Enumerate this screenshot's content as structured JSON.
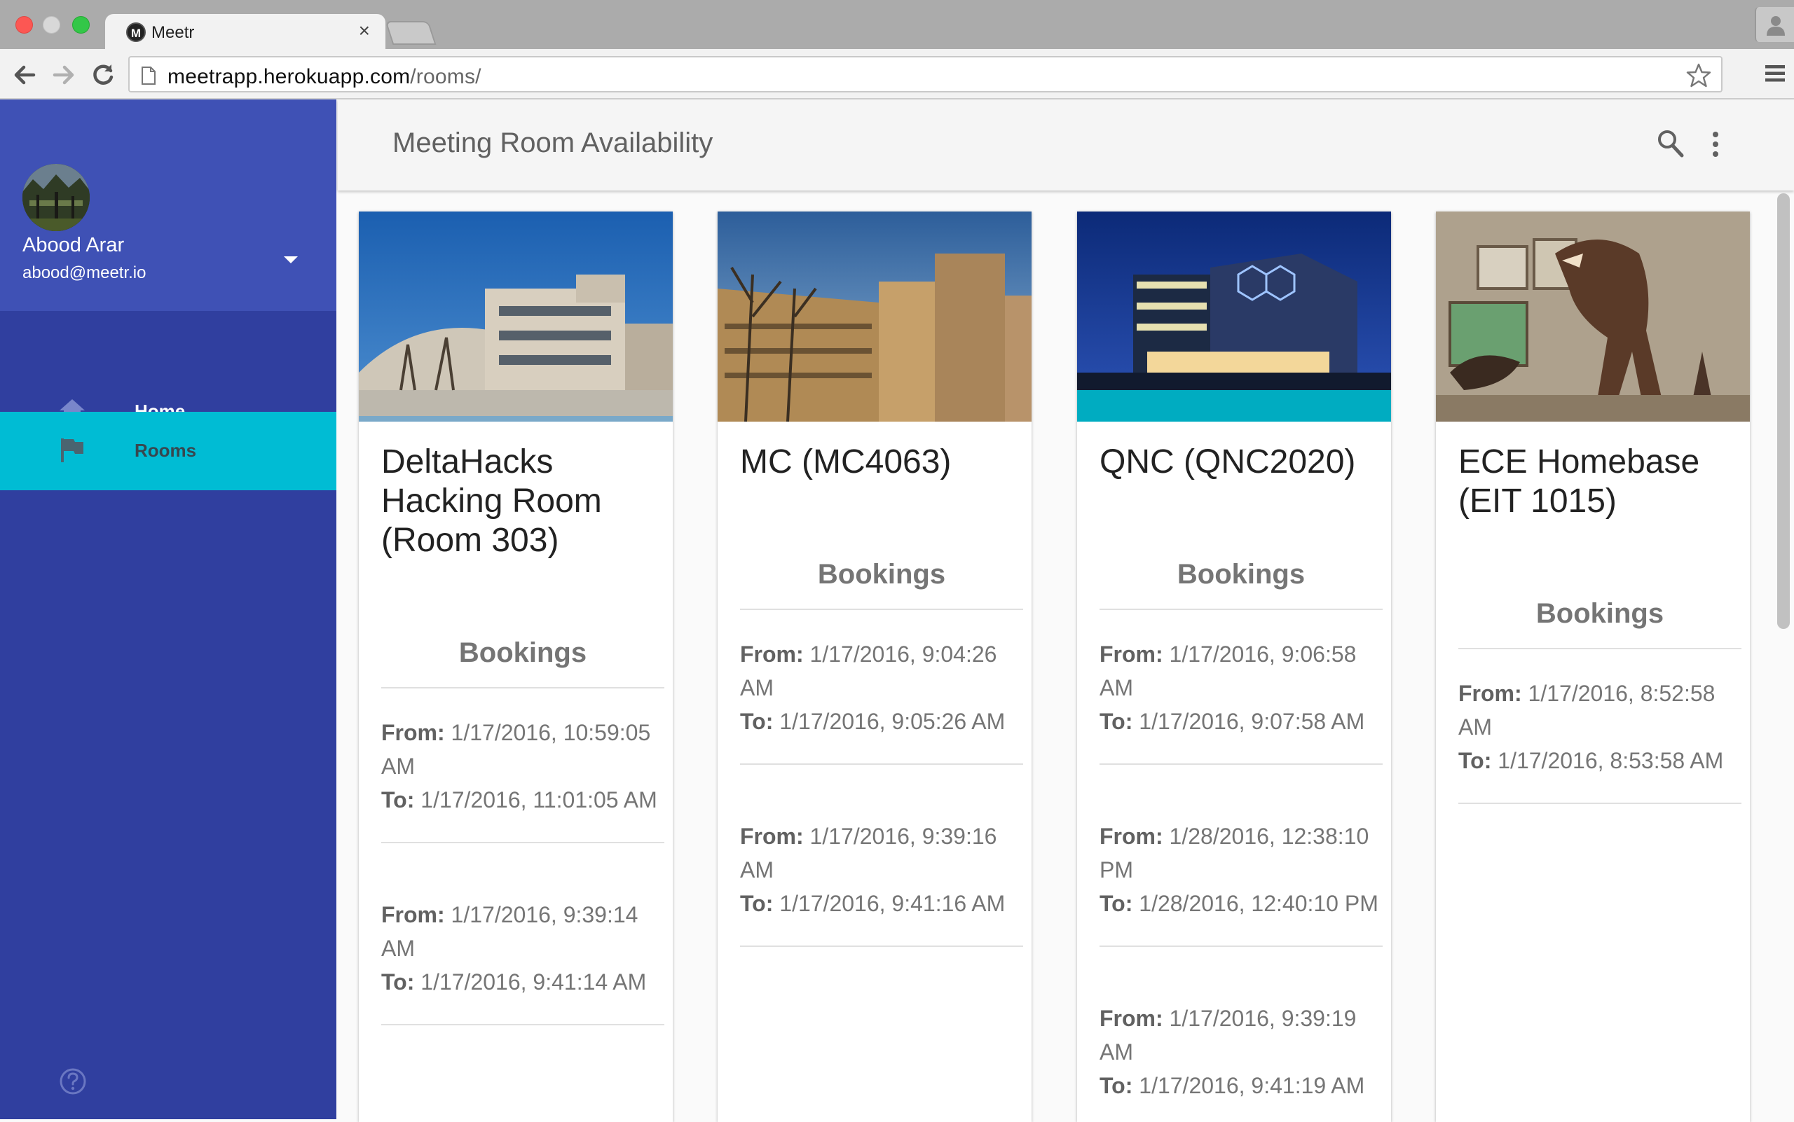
{
  "browser": {
    "tab_title": "Meetr",
    "tab_favicon": "M",
    "tab_close": "×",
    "url_host": "meetrapp.herokuapp.com",
    "url_path": "/rooms/"
  },
  "sidebar": {
    "user_name": "Abood Arar",
    "user_email": "abood@meetr.io",
    "items": [
      {
        "label": "Home",
        "icon": "home-icon",
        "active": false
      },
      {
        "label": "Rooms",
        "icon": "flag-icon",
        "active": true
      }
    ],
    "accent": "#00bcd4",
    "header_color": "#3f51b5",
    "body_color": "#303f9f"
  },
  "appbar": {
    "title": "Meeting Room Availability"
  },
  "labels": {
    "bookings": "Bookings",
    "from": "From:",
    "to": "To:"
  },
  "rooms": [
    {
      "title": "DeltaHacks Hacking Room (Room 303)",
      "bookings": [
        {
          "from": "1/17/2016, 10:59:05 AM",
          "to": "1/17/2016, 11:01:05 AM"
        },
        {
          "from": "1/17/2016, 9:39:14 AM",
          "to": "1/17/2016, 9:41:14 AM"
        }
      ]
    },
    {
      "title": "MC (MC4063)",
      "bookings": [
        {
          "from": "1/17/2016, 9:04:26 AM",
          "to": "1/17/2016, 9:05:26 AM"
        },
        {
          "from": "1/17/2016, 9:39:16 AM",
          "to": "1/17/2016, 9:41:16 AM"
        }
      ]
    },
    {
      "title": "QNC (QNC2020)",
      "bookings": [
        {
          "from": "1/17/2016, 9:06:58 AM",
          "to": "1/17/2016, 9:07:58 AM"
        },
        {
          "from": "1/28/2016, 12:38:10 PM",
          "to": "1/28/2016, 12:40:10 PM"
        },
        {
          "from": "1/17/2016, 9:39:19 AM",
          "to": "1/17/2016, 9:41:19 AM"
        }
      ]
    },
    {
      "title": "ECE Homebase (EIT 1015)",
      "bookings": [
        {
          "from": "1/17/2016, 8:52:58 AM",
          "to": "1/17/2016, 8:53:58 AM"
        }
      ]
    }
  ]
}
